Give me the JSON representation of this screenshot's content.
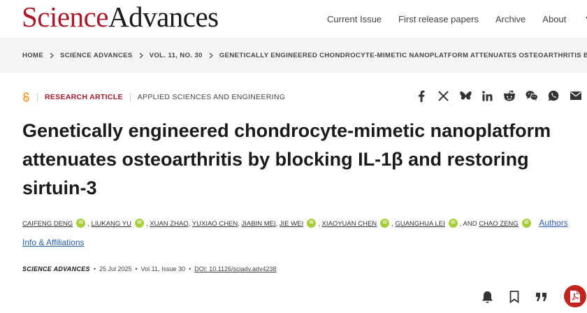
{
  "header": {
    "logo_part1": "Science",
    "logo_part2": "Advances",
    "nav": [
      "Current Issue",
      "First release papers",
      "Archive",
      "About"
    ]
  },
  "breadcrumb": [
    "HOME",
    "SCIENCE ADVANCES",
    "VOL. 11, NO. 30",
    "GENETICALLY ENGINEERED CHONDROCYTE-MIMETIC NANOPLATFORM ATTENUATES OSTEOARTHRITIS BY…"
  ],
  "article": {
    "type": "RESEARCH ARTICLE",
    "subject": "APPLIED SCIENCES AND ENGINEERING",
    "title": "Genetically engineered chondrocyte-mimetic nanoplatform attenuates osteoarthritis by blocking IL-1β and restoring sirtuin-3",
    "authors": [
      "CAIFENG DENG",
      "LIUKANG YU",
      "XUAN ZHAO",
      "YUXIAO CHEN",
      "JIABIN MEI",
      "JIE WEI",
      "XIAOYUAN CHEN",
      "GUANGHUA LEI",
      "CHAO ZENG"
    ],
    "and_text": "AND",
    "affiliations_link": "Authors Info & Affiliations",
    "journal": "SCIENCE ADVANCES",
    "date": "25 Jul 2025",
    "volume": "Vol 11, Issue 30",
    "doi": "DOI: 10.1126/sciadv.adv4238"
  },
  "share_icons": [
    "facebook-icon",
    "x-icon",
    "bluesky-icon",
    "linkedin-icon",
    "reddit-icon",
    "wechat-icon",
    "whatsapp-icon",
    "email-icon"
  ],
  "tool_icons": [
    "bell-icon",
    "bookmark-icon",
    "quote-icon",
    "pdf-icon"
  ],
  "colors": {
    "brand": "#a8192a",
    "link": "#2a5db0",
    "orcid": "#a6ce39",
    "pdf": "#c0261f",
    "open_access": "#f28e1c"
  }
}
